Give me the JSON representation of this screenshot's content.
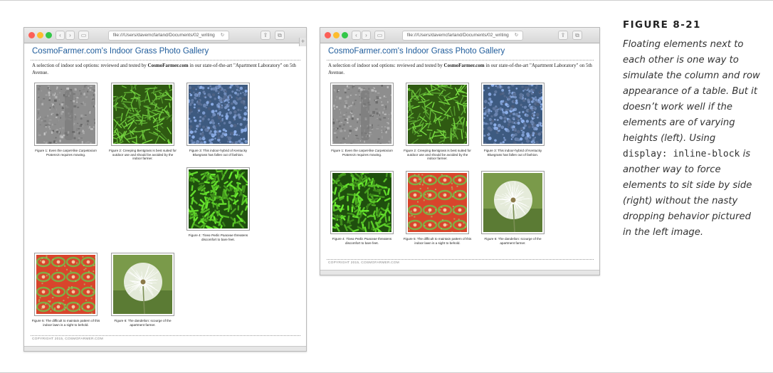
{
  "figure": {
    "label": "FIGURE 8-21",
    "caption": {
      "part1": "Floating elements next to each other is one way to simulate the column and row appearance of a table. But it doesn’t work well if the elements are of varying heights (left). Using",
      "code": "display: inline-block",
      "part2": "is another way to force elements to sit side by side (right) without the nasty dropping behavior pictured in the left image."
    }
  },
  "browser": {
    "address": "file:///Users/davemcfarland/Documents/02_writing",
    "reload_icon": "↻",
    "share_icon": "⇪",
    "tabs_icon": "⧉",
    "plus_tab": "+",
    "nav_back": "‹",
    "nav_forward": "›",
    "sidebar_icon": "▭",
    "colors": {
      "close": "#fc5f57",
      "minimize": "#fdbc2e",
      "zoom": "#33c748"
    }
  },
  "gallery": {
    "title": "CosmoFarmer.com's Indoor Grass Photo Gallery",
    "intro_before": "A selection of indoor sod options: reviewed and tested by ",
    "intro_brand": "CosmoFarmer.com",
    "intro_after": " in our state-of-the-art \"Apartment Laboratory\" on 5th Avenue.",
    "footer": "COPYRIGHT 2015, COSMOFARMER.COM",
    "figures": [
      {
        "pre": "Figure 1: Even the carpet-like ",
        "em": "Carpetorium Pratensis",
        "post": " requires mowing.",
        "image": "gray-carpet"
      },
      {
        "pre": "Figure 2: Creeping Bentgrass is best suited for outdoor use and should be avoided by the indoor farmer.",
        "em": "",
        "post": "",
        "image": "green-grass"
      },
      {
        "pre": "Figure 3: This indoor-hybrid of Kentucky Bluegrass has fallen out of fashion.",
        "em": "",
        "post": "",
        "image": "blue-grass"
      },
      {
        "pre": "Figure 4: ",
        "em": "Tinea Pedis Poaceae",
        "post": " threatens discomfort to bare feet.",
        "image": "dense-grass"
      },
      {
        "pre": "Figure 5: The difficult to maintain pattern of this indoor lawn is a sight to behold.",
        "em": "",
        "post": "",
        "image": "patterned-lawn"
      },
      {
        "pre": "Figure 6: The dandelion: scourge of the apartment farmer.",
        "em": "",
        "post": "",
        "image": "dandelion"
      }
    ]
  }
}
